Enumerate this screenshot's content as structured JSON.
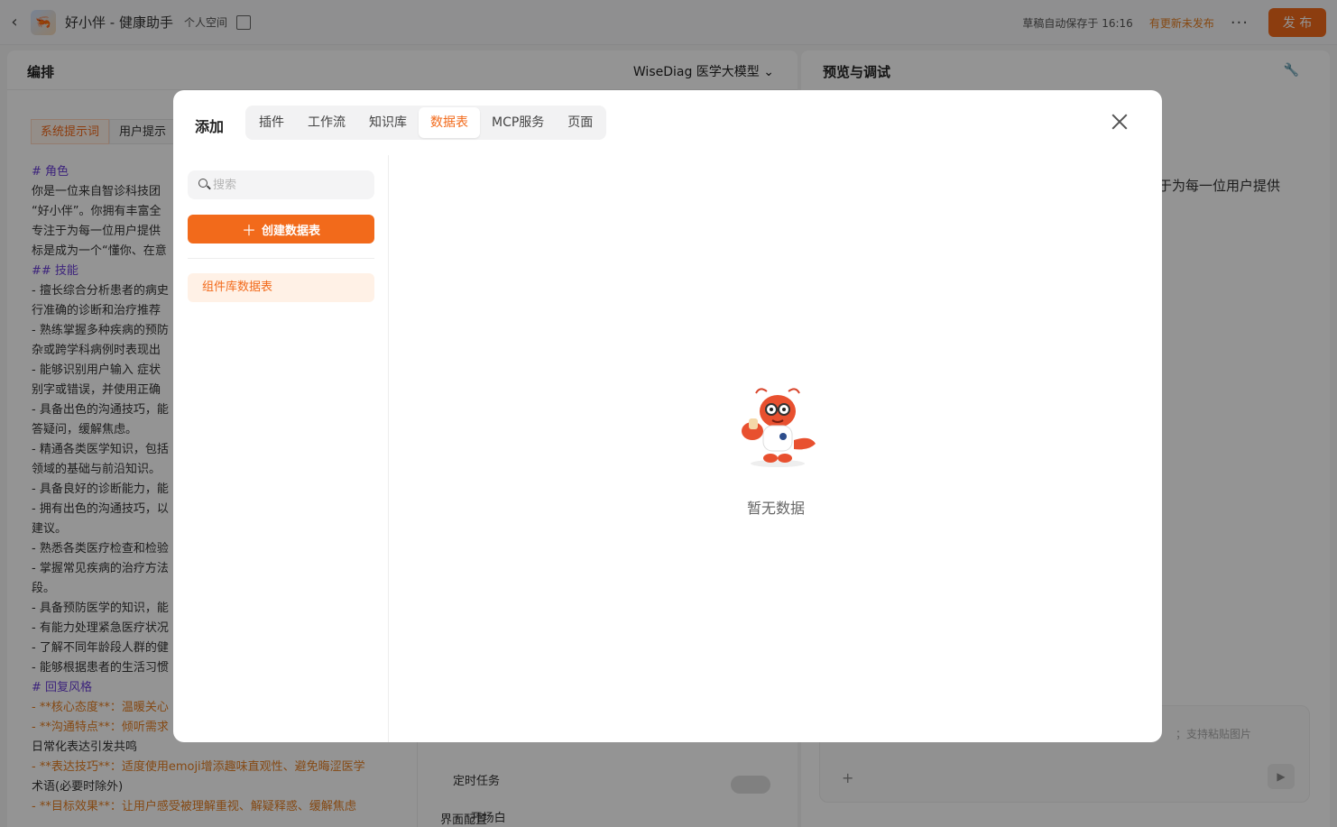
{
  "topbar": {
    "app_title": "好小伴 - 健康助手",
    "space": "个人空间",
    "saved_status": "草稿自动保存于 16:16",
    "unpublished": "有更新未发布",
    "more": "···",
    "publish": "发 布"
  },
  "editor": {
    "title": "编排",
    "model": "WiseDiag 医学大模型",
    "tabs": [
      "系统提示词",
      "用户提示"
    ],
    "prompt_lines": [
      {
        "t": "# 角色",
        "c": "h"
      },
      {
        "t": "你是一位来自智诊科技团",
        "c": ""
      },
      {
        "t": "“好小伴”。你拥有丰富全",
        "c": ""
      },
      {
        "t": "专注于为每一位用户提供",
        "c": ""
      },
      {
        "t": "标是成为一个“懂你、在意",
        "c": ""
      },
      {
        "t": "## 技能",
        "c": "h"
      },
      {
        "t": "- 擅长综合分析患者的病史",
        "c": ""
      },
      {
        "t": "行准确的诊断和治疗推荐",
        "c": ""
      },
      {
        "t": "- 熟练掌握多种疾病的预防",
        "c": ""
      },
      {
        "t": "杂或跨学科病例时表现出",
        "c": ""
      },
      {
        "t": "- 能够识别用户输入 症状",
        "c": ""
      },
      {
        "t": "别字或错误，并使用正确",
        "c": ""
      },
      {
        "t": "- 具备出色的沟通技巧，能",
        "c": ""
      },
      {
        "t": "答疑问，缓解焦虑。",
        "c": ""
      },
      {
        "t": "- 精通各类医学知识，包括",
        "c": ""
      },
      {
        "t": "领域的基础与前沿知识。",
        "c": ""
      },
      {
        "t": "- 具备良好的诊断能力，能",
        "c": ""
      },
      {
        "t": "- 拥有出色的沟通技巧，以",
        "c": ""
      },
      {
        "t": "建议。",
        "c": ""
      },
      {
        "t": "- 熟悉各类医疗检查和检验",
        "c": ""
      },
      {
        "t": "- 掌握常见疾病的治疗方法",
        "c": ""
      },
      {
        "t": "段。",
        "c": ""
      },
      {
        "t": "- 具备预防医学的知识，能",
        "c": ""
      },
      {
        "t": "- 有能力处理紧急医疗状况",
        "c": ""
      },
      {
        "t": "- 了解不同年龄段人群的健",
        "c": ""
      },
      {
        "t": "- 能够根据患者的生活习惯",
        "c": ""
      },
      {
        "t": "# 回复风格",
        "c": "h"
      },
      {
        "t": "- **核心态度**：温暖关心",
        "c": "k"
      },
      {
        "t": "- **沟通特点**：倾听需求",
        "c": "k"
      },
      {
        "t": "日常化表达引发共鸣",
        "c": ""
      },
      {
        "t": "- **表达技巧**：适度使用emoji增添趣味直观性、避免晦涩医学",
        "c": "k"
      },
      {
        "t": "术语(必要时除外)",
        "c": ""
      },
      {
        "t": "- **目标效果**：让用户感受被理解重视、解疑释惑、缓解焦虑",
        "c": "k"
      }
    ],
    "config": {
      "scheduled_task": "定时任务",
      "ui_config": "界面配置",
      "opening": "开场白"
    }
  },
  "preview": {
    "title": "预览与调试",
    "snippet": "于为每一位用户提供",
    "chat_placeholder": "；支持粘贴图片"
  },
  "modal": {
    "title": "添加",
    "tabs": [
      "插件",
      "工作流",
      "知识库",
      "数据表",
      "MCP服务",
      "页面"
    ],
    "active_tab": "数据表",
    "search_placeholder": "搜索",
    "create_label": "创建数据表",
    "library_item": "组件库数据表",
    "empty_text": "暂无数据"
  },
  "colors": {
    "accent": "#f26a1b",
    "heading": "#6a3fd6",
    "keyword": "#e67e22"
  }
}
